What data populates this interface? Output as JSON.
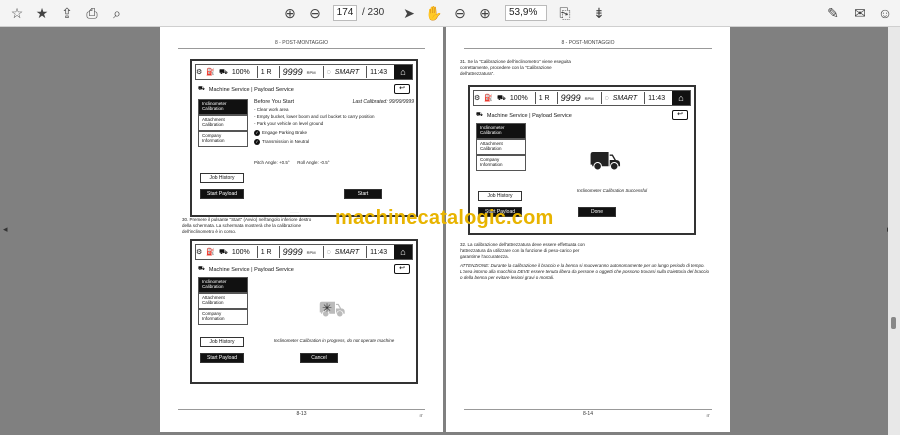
{
  "toolbar": {
    "current_page": "174",
    "total_pages": "/ 230",
    "zoom": "53,9%"
  },
  "watermark": "machinecatalogic.com",
  "left_page": {
    "header": "8 - POST-MONTAGGIO",
    "footer_page": "8-13",
    "footer_right": "IT",
    "screen1": {
      "status": {
        "pct": "100%",
        "gear": "1 R",
        "rpm": "9999",
        "rpm_unit": "RPM",
        "mode": "SMART",
        "time": "11:43"
      },
      "title": "Machine Service | Payload Service",
      "menu": [
        "Inclinometer Calibration",
        "Attachment Calibration",
        "Company Information"
      ],
      "before": "Before You Start",
      "last_cal": "Last Calibrated: 99/99/9999",
      "steps": [
        "- Clear work area",
        "- Empty bucket, lower boom and curl bucket to carry position",
        "- Park your vehicle on level ground"
      ],
      "checks": [
        "Engage Parking Brake",
        "Transmission in Neutral"
      ],
      "pitch": "Pitch Angle: +0.5°",
      "roll": "Roll Angle: -0.5°",
      "job_history": "Job History",
      "start_payload": "Start Payload",
      "start": "Start"
    },
    "step30": "30. Premere il pulsante \"Start\" (Avvio) nell'angolo inferiore destro della schermata. La schermata mostrerà che la calibrazione dell'inclinometro è in corso.",
    "screen2": {
      "status": {
        "pct": "100%",
        "gear": "1 R",
        "rpm": "9999",
        "rpm_unit": "RPM",
        "mode": "SMART",
        "time": "11:43"
      },
      "title": "Machine Service | Payload Service",
      "menu": [
        "Inclinometer Calibration",
        "Attachment Calibration",
        "Company Information"
      ],
      "progress": "Inclinometer Calibration in progress, do not operate machine",
      "job_history": "Job History",
      "start_payload": "Start Payload",
      "cancel": "Cancel"
    }
  },
  "right_page": {
    "header": "8 - POST-MONTAGGIO",
    "footer_page": "8-14",
    "footer_right": "IT",
    "step31": "31. Se la \"Calibrazione dell'inclinometro\" viene eseguita correttamente, procedere con la \"Calibrazione dell'attrezzatura\".",
    "screen3": {
      "status": {
        "pct": "100%",
        "gear": "1 R",
        "rpm": "9999",
        "rpm_unit": "RPM",
        "mode": "SMART",
        "time": "11:43"
      },
      "title": "Machine Service | Payload Service",
      "menu": [
        "Inclinometer Calibration",
        "Attachment Calibration",
        "Company Information"
      ],
      "success": "Inclinometer Calibration Successful",
      "job_history": "Job History",
      "start_payload": "Start Payload",
      "done": "Done"
    },
    "step32": "32. La calibrazione dell'attrezzatura deve essere effettuata con l'attrezzatura da utilizzare con la funzione di peso-carico per garantirne l'accuratezza.",
    "attention": "ATTENZIONE: Durante la calibrazione il braccio e la benna si muoveranno autonomamente per un lungo periodo di tempo. L'area intorno alla macchina DEVE essere tenuta libera da persone o oggetti che possono trovarsi sulla traiettoria del braccio o della benna per evitare lesioni gravi o mortali."
  }
}
